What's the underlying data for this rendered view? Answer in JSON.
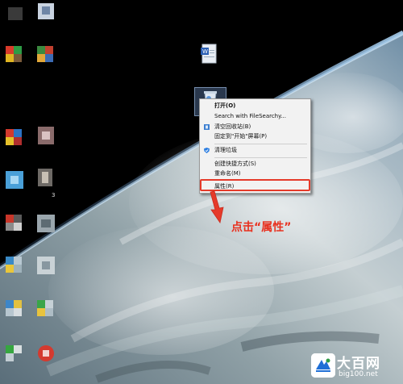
{
  "context_menu": {
    "items": [
      {
        "label": "打开(O)",
        "icon": "",
        "bold": true
      },
      {
        "label": "Search with FileSearchy...",
        "icon": ""
      },
      {
        "label": "清空回收站(B)",
        "icon": "clear-recycle-icon"
      },
      {
        "label": "固定到\"开始\"屏幕(P)",
        "icon": ""
      },
      {
        "label": "清理垃圾",
        "icon": "shield-cleanup-icon"
      },
      {
        "label": "创建快捷方式(S)",
        "icon": ""
      },
      {
        "label": "重命名(M)",
        "icon": ""
      },
      {
        "label": "属性(R)",
        "icon": ""
      }
    ]
  },
  "annotation": {
    "text": "点击“属性”",
    "color": "#e8311f"
  },
  "watermark": {
    "name": "大百网",
    "url": "big100.net"
  },
  "desktop_icons": {
    "partial_label": "3"
  },
  "colors": {
    "highlight_border": "#e53a2a",
    "menu_bg": "#f2f2f2"
  }
}
